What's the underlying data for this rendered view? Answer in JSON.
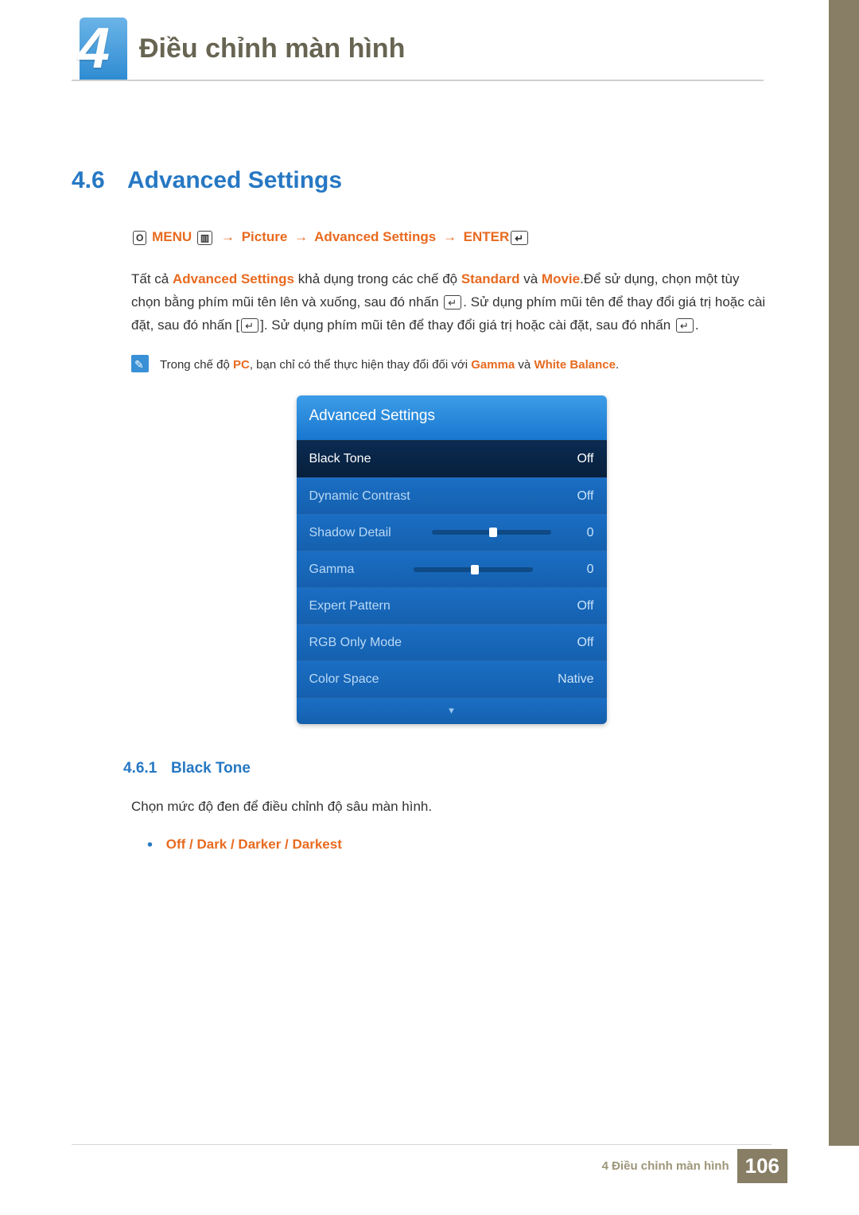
{
  "chapter": {
    "number": "4",
    "title": "Điều chỉnh màn hình"
  },
  "section": {
    "number": "4.6",
    "title": "Advanced Settings"
  },
  "breadcrumb": {
    "hand_label": "O",
    "menu_label": "MENU",
    "menu_icon": "▥",
    "item1": "Picture",
    "item2": "Advanced Settings",
    "item3": "ENTER"
  },
  "body": {
    "p1_a": "Tất cả ",
    "p1_hl1": "Advanced Settings",
    "p1_b": " khả dụng trong các chế độ ",
    "p1_hl2": "Standard",
    "p1_c": " và ",
    "p1_hl3": "Movie",
    "p1_d": ".Để sử dụng, chọn một tùy chọn bằng phím mũi tên lên và xuống, sau đó nhấn ",
    "p1_e": ". Sử dụng phím mũi tên để thay đổi giá trị hoặc cài đặt, sau đó nhấn [",
    "p1_f": "]. Sử dụng phím mũi tên để thay đổi giá trị hoặc cài đặt, sau đó nhấn ",
    "p1_g": "."
  },
  "note": {
    "a": "Trong chế độ ",
    "hl1": "PC",
    "b": ", bạn chỉ có thể thực hiện thay đổi đối với ",
    "hl2": "Gamma",
    "c": " và ",
    "hl3": "White Balance",
    "d": "."
  },
  "osd": {
    "title": "Advanced Settings",
    "rows": [
      {
        "label": "Black Tone",
        "value": "Off",
        "selected": true,
        "slider": false
      },
      {
        "label": "Dynamic Contrast",
        "value": "Off",
        "selected": false,
        "slider": false
      },
      {
        "label": "Shadow Detail",
        "value": "0",
        "selected": false,
        "slider": true
      },
      {
        "label": "Gamma",
        "value": "0",
        "selected": false,
        "slider": true
      },
      {
        "label": "Expert Pattern",
        "value": "Off",
        "selected": false,
        "slider": false
      },
      {
        "label": "RGB Only Mode",
        "value": "Off",
        "selected": false,
        "slider": false
      },
      {
        "label": "Color Space",
        "value": "Native",
        "selected": false,
        "slider": false
      }
    ],
    "footer_glyph": "▾"
  },
  "subsection": {
    "number": "4.6.1",
    "title": "Black Tone",
    "para": "Chọn mức độ đen để điều chỉnh độ sâu màn hình.",
    "options": "Off / Dark / Darker / Darkest"
  },
  "footer": {
    "text": "4 Điều chỉnh màn hình",
    "page": "106"
  }
}
